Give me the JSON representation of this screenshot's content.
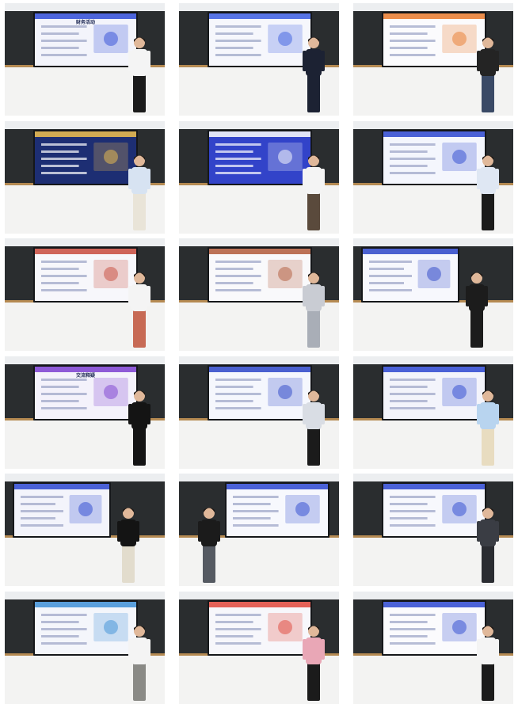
{
  "photos": [
    {
      "screen_title": "财务活动",
      "screen_bg": "#f3f4fb",
      "accent": "#2f4bd6",
      "shirt": "#f4f4f4",
      "bottom": "#1b1b1b",
      "side": "right"
    },
    {
      "screen_title": "",
      "screen_bg": "#f6f7fc",
      "accent": "#3b5de0",
      "shirt": "#1c2233",
      "bottom": "#1c2233",
      "side": "right"
    },
    {
      "screen_title": "",
      "screen_bg": "#fbfbfd",
      "accent": "#e8792c",
      "shirt": "#242424",
      "bottom": "#3a4a66",
      "side": "right"
    },
    {
      "screen_title": "",
      "screen_bg": "#1d2e73",
      "accent": "#f2c14e",
      "shirt": "#d7e3f2",
      "bottom": "#e9e4d8",
      "side": "right"
    },
    {
      "screen_title": "",
      "screen_bg": "#3243c9",
      "accent": "#ffffff",
      "shirt": "#f4f4f4",
      "bottom": "#5a4a3c",
      "side": "right"
    },
    {
      "screen_title": "",
      "screen_bg": "#f4f6fd",
      "accent": "#2c47d0",
      "shirt": "#dfe7f3",
      "bottom": "#1b1b1b",
      "side": "right"
    },
    {
      "screen_title": "",
      "screen_bg": "#f7f7fb",
      "accent": "#c84a3c",
      "shirt": "#f4f4f4",
      "bottom": "#c76a55",
      "side": "right"
    },
    {
      "screen_title": "",
      "screen_bg": "#f9f9fb",
      "accent": "#b25a3a",
      "shirt": "#c9ccd3",
      "bottom": "#a9aeb7",
      "side": "right"
    },
    {
      "screen_title": "",
      "screen_bg": "#f7f8fd",
      "accent": "#2b45c8",
      "shirt": "#1c1c1c",
      "bottom": "#1c1c1c",
      "side": "center"
    },
    {
      "screen_title": "交流释疑",
      "screen_bg": "#f4f2fb",
      "accent": "#7b3fd0",
      "shirt": "#141414",
      "bottom": "#141414",
      "side": "right"
    },
    {
      "screen_title": "",
      "screen_bg": "#f5f7fd",
      "accent": "#2b45c8",
      "shirt": "#d9dde4",
      "bottom": "#1b1b1b",
      "side": "right"
    },
    {
      "screen_title": "",
      "screen_bg": "#f3f4fb",
      "accent": "#2c47d0",
      "shirt": "#b8d4ef",
      "bottom": "#e8dcc0",
      "side": "right"
    },
    {
      "screen_title": "",
      "screen_bg": "#f3f4fb",
      "accent": "#2c47d0",
      "shirt": "#141414",
      "bottom": "#e2dccd",
      "side": "center"
    },
    {
      "screen_title": "",
      "screen_bg": "#f7f8fd",
      "accent": "#2c47d0",
      "shirt": "#1b1b1b",
      "bottom": "#555a62",
      "side": "left"
    },
    {
      "screen_title": "",
      "screen_bg": "#f7f8fd",
      "accent": "#2c47d0",
      "shirt": "#3a3d44",
      "bottom": "#2a2c31",
      "side": "right"
    },
    {
      "screen_title": "",
      "screen_bg": "#f4f6fb",
      "accent": "#3e8fd6",
      "shirt": "#f4f4f4",
      "bottom": "#8a8a86",
      "side": "right"
    },
    {
      "screen_title": "",
      "screen_bg": "#f7f7fb",
      "accent": "#e0463a",
      "shirt": "#e9a7b6",
      "bottom": "#1b1b1b",
      "side": "right"
    },
    {
      "screen_title": "",
      "screen_bg": "#fbfbfd",
      "accent": "#2c47d0",
      "shirt": "#f4f4f4",
      "bottom": "#1b1b1b",
      "side": "right"
    }
  ]
}
